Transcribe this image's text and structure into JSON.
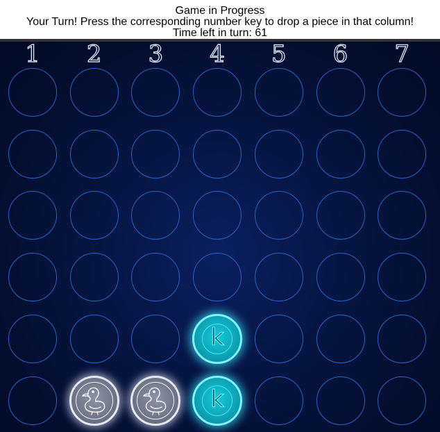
{
  "header": {
    "status": "Game in Progress",
    "instruction": "Your Turn! Press the corresponding number key to drop a piece in that column!",
    "timer": "Time left in turn: 61"
  },
  "board": {
    "columns": [
      "1",
      "2",
      "3",
      "4",
      "5",
      "6",
      "7"
    ],
    "rows": 6,
    "grid": [
      [
        "",
        "",
        "",
        "",
        "",
        "",
        ""
      ],
      [
        "",
        "",
        "",
        "",
        "",
        "",
        ""
      ],
      [
        "",
        "",
        "",
        "",
        "",
        "",
        ""
      ],
      [
        "",
        "",
        "",
        "",
        "",
        "",
        ""
      ],
      [
        "",
        "",
        "",
        "k",
        "",
        "",
        ""
      ],
      [
        "",
        "duck",
        "duck",
        "k",
        "",
        "",
        ""
      ]
    ],
    "piece_glyph_k": "k"
  },
  "colors": {
    "board_bg": "#061543",
    "cell_border": "#2363c7",
    "player_k": "#13c9d6",
    "player_duck": "#6f7587"
  },
  "icons": {
    "player_k": "letter-k-icon",
    "player_duck": "duck-icon"
  }
}
